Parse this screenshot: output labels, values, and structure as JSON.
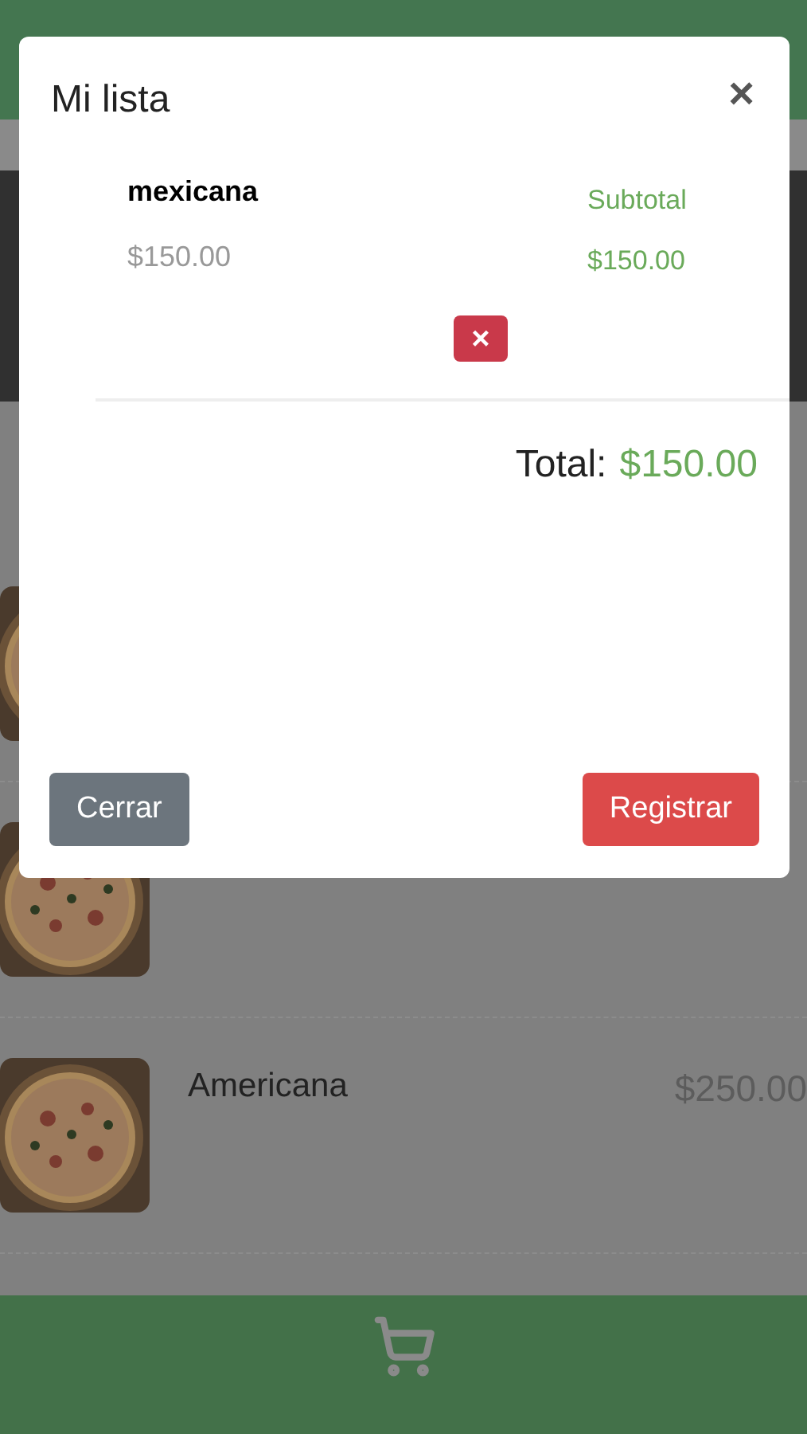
{
  "menu_items": [
    {
      "kind": "picture"
    },
    {
      "kind": "picture"
    },
    {
      "kind": "picture",
      "name": "Americana",
      "price": "$250.00"
    }
  ],
  "modal": {
    "title": "Mi lista",
    "close": "×",
    "items": [
      {
        "name": "mexicana",
        "price": "$150.00",
        "subtotal_label": "Subtotal",
        "subtotal": "$150.00",
        "remove": "×"
      }
    ],
    "total_label": "Total:",
    "total": "$150.00",
    "buttons": [
      {
        "label": "Cerrar",
        "kind": "secondary"
      },
      {
        "label": "Registrar",
        "kind": "danger"
      }
    ]
  }
}
